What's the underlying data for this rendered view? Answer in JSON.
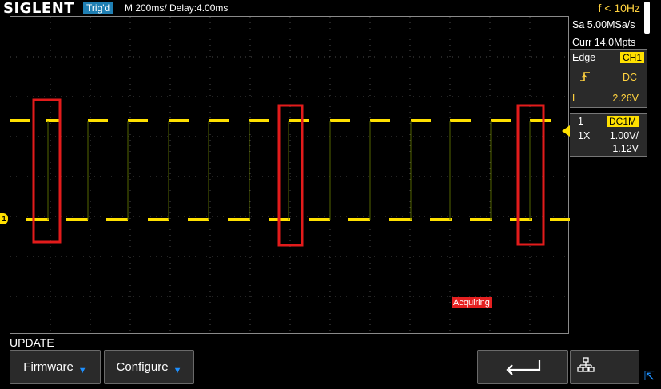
{
  "header": {
    "brand": "SIGLENT",
    "trigger_status": "Trig'd",
    "timebase": "M 200ms/  Delay:4.00ms",
    "frequency": "f < 10Hz"
  },
  "acquisition": {
    "sample_rate": "Sa 5.00MSa/s",
    "memory_depth": "Curr 14.0Mpts"
  },
  "trigger": {
    "type_label": "Edge",
    "source": "CH1",
    "coupling": "DC",
    "level_label": "L",
    "level": "2.26V"
  },
  "channel1": {
    "number": "1",
    "coupling": "DC1M",
    "probe": "1X",
    "volts_per_div": "1.00V/",
    "offset": "-1.12V",
    "marker_label": "1"
  },
  "status": {
    "acquiring": "Acquiring"
  },
  "menu": {
    "title": "UPDATE",
    "firmware_label": "Firmware",
    "configure_label": "Configure"
  },
  "colors": {
    "trace": "#ffe000",
    "highlight_box": "#e31b1b",
    "accent_blue": "#1f7fb3"
  }
}
